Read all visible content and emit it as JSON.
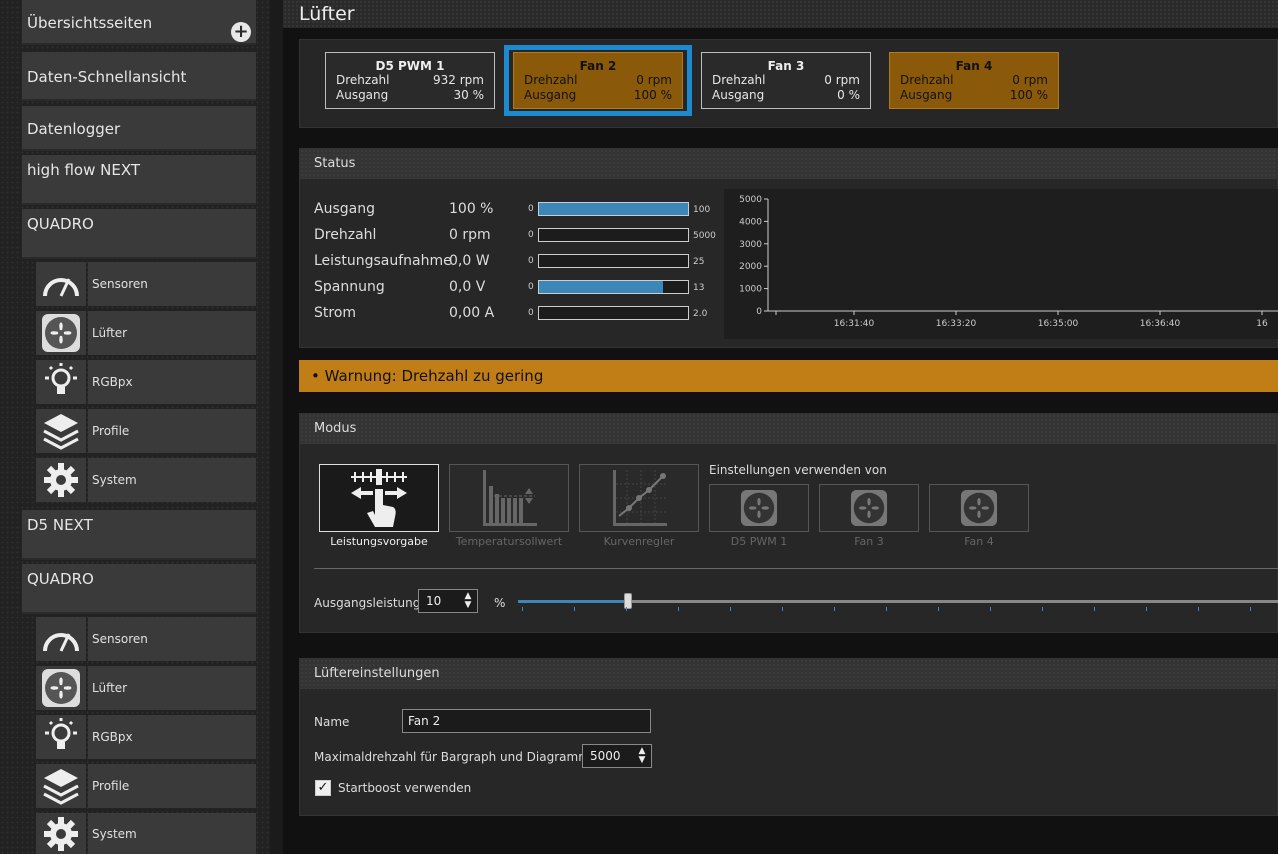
{
  "sidebar": {
    "overview": "Übersichtsseiten",
    "quick_view": "Daten-Schnellansicht",
    "logger": "Datenlogger",
    "device1": "high flow NEXT",
    "device2": "QUADRO",
    "device2_items": [
      "Sensoren",
      "Lüfter",
      "RGBpx",
      "Profile",
      "System"
    ],
    "device3": "D5 NEXT",
    "device4": "QUADRO",
    "device4_items": [
      "Sensoren",
      "Lüfter",
      "RGBpx",
      "Profile",
      "System"
    ]
  },
  "page_title": "Lüfter",
  "fans": [
    {
      "name": "D5 PWM 1",
      "speed_label": "Drehzahl",
      "speed": "932 rpm",
      "output_label": "Ausgang",
      "output": "30 %"
    },
    {
      "name": "Fan 2",
      "speed_label": "Drehzahl",
      "speed": "0 rpm",
      "output_label": "Ausgang",
      "output": "100 %"
    },
    {
      "name": "Fan 3",
      "speed_label": "Drehzahl",
      "speed": "0 rpm",
      "output_label": "Ausgang",
      "output": "0 %"
    },
    {
      "name": "Fan 4",
      "speed_label": "Drehzahl",
      "speed": "0 rpm",
      "output_label": "Ausgang",
      "output": "100 %"
    }
  ],
  "status": {
    "title": "Status",
    "rows": [
      {
        "label": "Ausgang",
        "value": "100 %",
        "min": "0",
        "max": "100",
        "fill": 1.0
      },
      {
        "label": "Drehzahl",
        "value": "0 rpm",
        "min": "0",
        "max": "5000",
        "fill": 0.0
      },
      {
        "label": "Leistungsaufnahme",
        "value": "0,0 W",
        "min": "0",
        "max": "25",
        "fill": 0.0
      },
      {
        "label": "Spannung",
        "value": "0,0 V",
        "min": "0",
        "max": "13",
        "fill": 0.83
      },
      {
        "label": "Strom",
        "value": "0,00 A",
        "min": "0",
        "max": "2.0",
        "fill": 0.0
      }
    ],
    "graph_y": [
      "5000",
      "4000",
      "3000",
      "2000",
      "1000",
      "0"
    ],
    "graph_x": [
      "16:31:40",
      "16:33:20",
      "16:35:00",
      "16:36:40",
      "16"
    ]
  },
  "warning": "• Warnung: Drehzahl zu gering",
  "mode": {
    "title": "Modus",
    "options": [
      "Leistungsvorgabe",
      "Temperatursollwert",
      "Kurvenregler"
    ],
    "source_label": "Einstellungen verwenden von",
    "sources": [
      "D5 PWM 1",
      "Fan 3",
      "Fan 4"
    ],
    "output_label": "Ausgangsleistung",
    "output_value": "10",
    "output_unit": "%",
    "output_fraction": 0.145
  },
  "settings": {
    "title": "Lüftereinstellungen",
    "name_label": "Name",
    "name_value": "Fan 2",
    "max_label": "Maximaldrehzahl für Bargraph und Diagramm",
    "max_value": "5000",
    "boost_label": "Startboost verwenden",
    "boost_checked": "✓"
  },
  "colors": {
    "accent": "#1c8ad0",
    "warning": "#c27e16",
    "fan_active": "#8a5a0a",
    "bar": "#3a87b8"
  }
}
